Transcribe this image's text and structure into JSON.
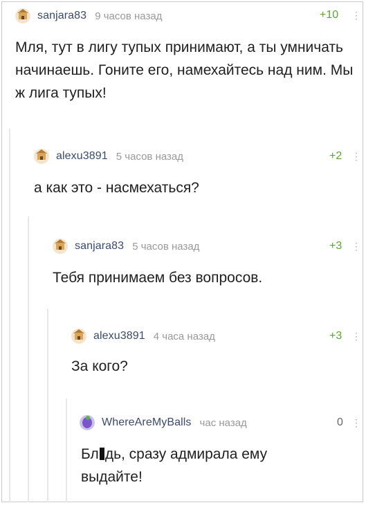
{
  "comments": [
    {
      "username": "sanjara83",
      "time": "9 часов назад",
      "rating": "+10",
      "menu": "⋮",
      "text": "Мля, тут в лигу тупых принимают, а ты умничать начинаешь. Гоните его, намехайтесь над ним. Мы ж лига тупых!"
    },
    {
      "username": "alexu3891",
      "time": "5 часов назад",
      "rating": "+2",
      "menu": "⋮",
      "text": "а как это - насмехаться?"
    },
    {
      "username": "sanjara83",
      "time": "5 часов назад",
      "rating": "+3",
      "menu": "⋮",
      "text": "Тебя принимаем без вопросов."
    },
    {
      "username": "alexu3891",
      "time": "4 часа назад",
      "rating": "+3",
      "menu": "⋮",
      "text": "За кого?"
    },
    {
      "username": "WhereAreMyBalls",
      "time": "час назад",
      "rating": "0",
      "menu": "⋮",
      "text_before": "Бл",
      "text_after": "дь, сразу адмирала ему выдайте!"
    }
  ],
  "colors": {
    "rating_positive": "#5aa534",
    "username": "#3b4a6b",
    "time": "#999999"
  },
  "icons": {
    "avatar_default": "house-avatar-icon",
    "avatar_special": "purple-figure-avatar-icon",
    "menu": "vertical-dots-icon"
  }
}
